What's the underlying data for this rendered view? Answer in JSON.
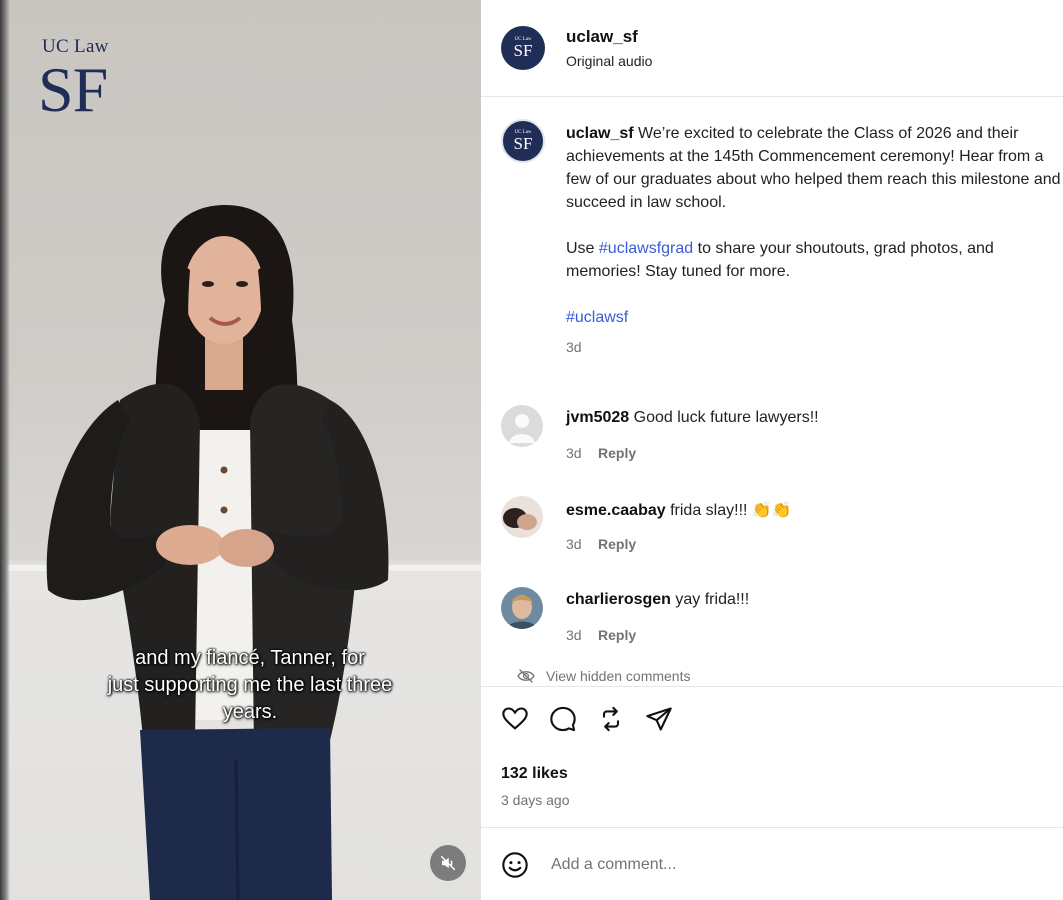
{
  "video": {
    "logo_small": "UC Law",
    "logo_big": "SF",
    "caption_line1": "and my fiancé, Tanner, for",
    "caption_line2": "just supporting me the last three",
    "caption_line3": "years.",
    "mute_icon": "volume-muted-icon"
  },
  "header": {
    "username": "uclaw_sf",
    "subtitle": "Original audio",
    "avatar_top": "UC Law",
    "avatar_big": "SF"
  },
  "post": {
    "username": "uclaw_sf",
    "text_1": "We’re excited to celebrate the Class of 2026 and their achievements at the 145th Commencement ceremony! Hear from a few of our graduates about who helped them reach this milestone and succeed in law school.",
    "text_2_pre": "Use ",
    "text_2_tag": "#uclawsfgrad",
    "text_2_post": " to share your shoutouts, grad photos, and memories! Stay tuned for more.",
    "tag": "#uclawsf",
    "time": "3d"
  },
  "comments": [
    {
      "username": "jvm5028",
      "text": "Good luck future lawyers!!",
      "time": "3d",
      "reply": "Reply"
    },
    {
      "username": "esme.caabay",
      "text": "frida slay!!! 👏👏",
      "time": "3d",
      "reply": "Reply"
    },
    {
      "username": "charlierosgen",
      "text": "yay frida!!!",
      "time": "3d",
      "reply": "Reply"
    }
  ],
  "hidden_comments": "View hidden comments",
  "actions": {
    "icons": [
      "heart-icon",
      "comment-icon",
      "repost-icon",
      "share-icon"
    ],
    "likes": "132 likes",
    "ago": "3 days ago"
  },
  "add_comment": {
    "placeholder": "Add a comment..."
  },
  "colors": {
    "brand_navy": "#1f2d57",
    "link_blue": "#3a5bd9",
    "muted": "#737373"
  }
}
